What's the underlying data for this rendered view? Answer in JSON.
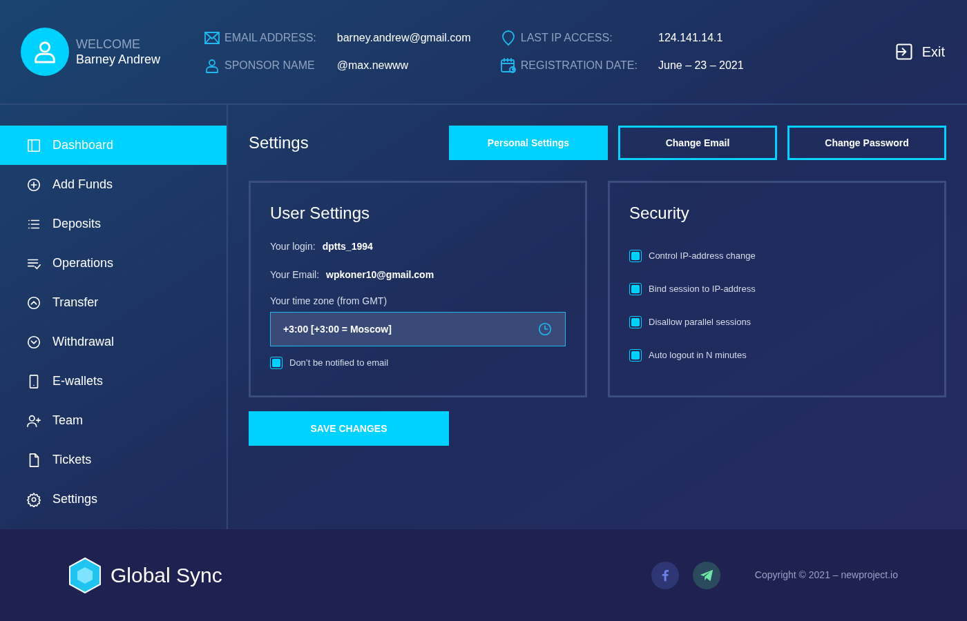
{
  "header": {
    "welcome": "WELCOME",
    "user_name": "Barney Andrew",
    "info": [
      {
        "label": "EMAIL ADDRESS:",
        "value": "barney.andrew@gmail.com"
      },
      {
        "label": "SPONSOR NAME",
        "value": "@max.newww"
      },
      {
        "label": "LAST IP ACCESS:",
        "value": "124.141.14.1"
      },
      {
        "label": "REGISTRATION DATE:",
        "value": "June – 23 – 2021"
      }
    ],
    "exit": "Exit"
  },
  "sidebar": {
    "items": [
      {
        "label": "Dashboard",
        "selected": true
      },
      {
        "label": "Add Funds",
        "selected": false
      },
      {
        "label": "Deposits",
        "selected": false
      },
      {
        "label": "Operations",
        "selected": false
      },
      {
        "label": "Transfer",
        "selected": false
      },
      {
        "label": "Withdrawal",
        "selected": false
      },
      {
        "label": "E-wallets",
        "selected": false
      },
      {
        "label": "Team",
        "selected": false
      },
      {
        "label": "Tickets",
        "selected": false
      },
      {
        "label": "Settings",
        "selected": false
      }
    ]
  },
  "page_title": "Settings",
  "tabs": [
    {
      "label": "Personal Settings",
      "selected": true
    },
    {
      "label": "Change Email",
      "selected": false
    },
    {
      "label": "Change Password",
      "selected": false
    }
  ],
  "user_settings": {
    "title": "User Settings",
    "fields": [
      {
        "label": "Your login:",
        "value": "dptts_1994"
      },
      {
        "label": "Your Email:",
        "value": "wpkoner10@gmail.com"
      }
    ],
    "timezone_label": "Your time zone (from GMT)",
    "timezone_value": "+3:00 [+3:00 = Moscow]",
    "notify": {
      "label": "Don’t be notified to email",
      "checked": true
    }
  },
  "security": {
    "title": "Security",
    "options": [
      {
        "label": "Control IP-address change",
        "checked": true
      },
      {
        "label": "Bind session to IP-address",
        "checked": true
      },
      {
        "label": "Disallow parallel sessions",
        "checked": true
      },
      {
        "label": "Auto logout in N minutes",
        "checked": true
      }
    ]
  },
  "save_button": "SAVE CHANGES",
  "footer": {
    "brand": "Global Sync",
    "copyright": "Copyright © 2021 – newproject.io"
  }
}
